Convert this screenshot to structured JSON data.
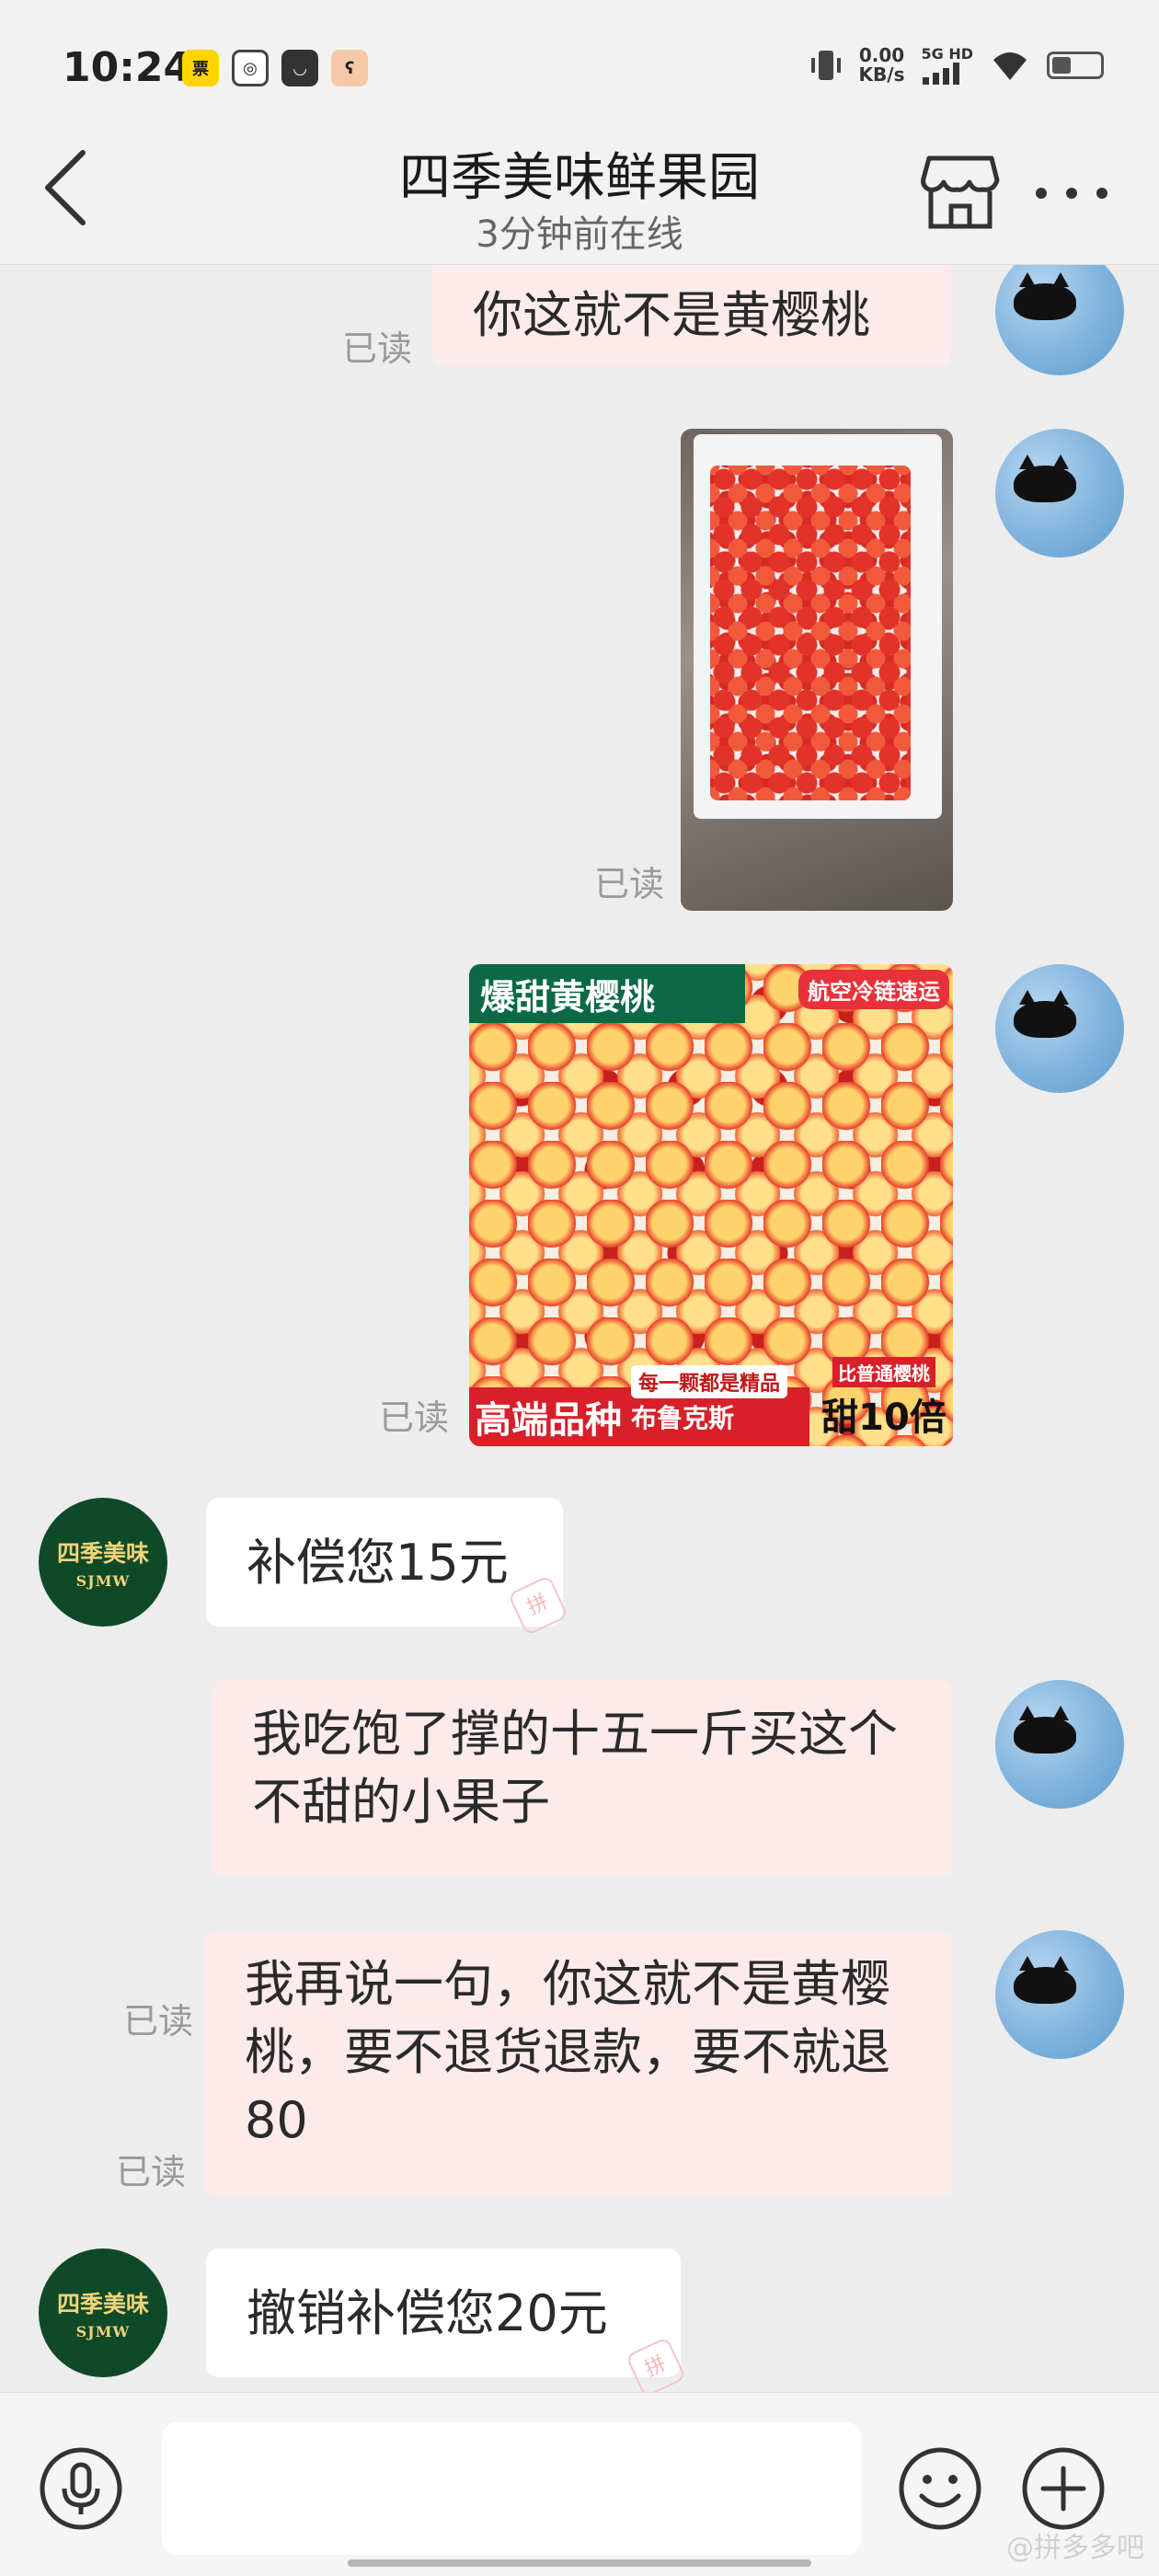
{
  "status_bar": {
    "time": "10:24",
    "app_icons": [
      "ticket-app-icon",
      "camera-app-icon",
      "shopping-bag-app-icon",
      "bear-app-icon"
    ],
    "net_speed_value": "0.00",
    "net_speed_unit": "KB/s",
    "network_type": "5G HD",
    "battery_level": 0.4
  },
  "header": {
    "shop_name": "四季美味鲜果园",
    "online_status": "3分钟前在线"
  },
  "shop_avatar": {
    "name_cn": "四季美味",
    "name_en": "SJMW"
  },
  "messages": [
    {
      "from": "user",
      "type": "text",
      "text": "你这就不是黄樱桃",
      "read_label": "已读"
    },
    {
      "from": "user",
      "type": "image",
      "read_label": "已读"
    },
    {
      "from": "user",
      "type": "image",
      "read_label": "已读",
      "ad": {
        "title": "爆甜黄樱桃",
        "top_tag": "航空冷链速运",
        "bottom_left_big": "高端品种",
        "bottom_left_small": "布鲁克斯",
        "badge": "每一颗都是精品",
        "right_tiny": "比普通樱桃",
        "right_big": "甜10倍"
      }
    },
    {
      "from": "shop",
      "type": "text",
      "text": "补偿您15元",
      "stamp": "拼"
    },
    {
      "from": "user",
      "type": "text",
      "text": "我吃饱了撑的十五一斤买这个不甜的小果子",
      "read_label": "已读"
    },
    {
      "from": "user",
      "type": "text",
      "text": "我再说一句，你这就不是黄樱桃，要不退货退款，要不就退80",
      "read_label": "已读"
    },
    {
      "from": "shop",
      "type": "text",
      "text": "撤销补偿您20元",
      "stamp": "拼"
    }
  ],
  "corner_watermark": "@拼多多吧"
}
